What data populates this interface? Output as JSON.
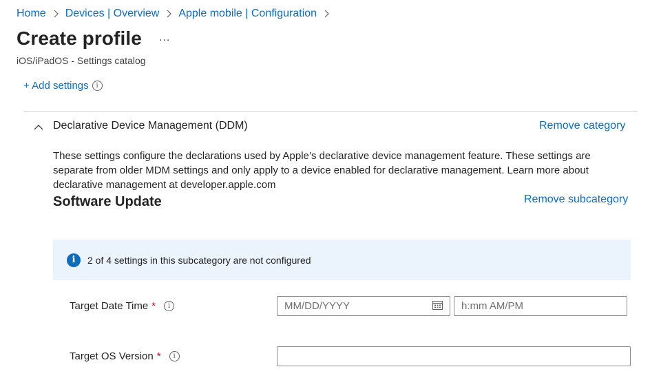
{
  "breadcrumb": [
    "Home",
    "Devices | Overview",
    "Apple mobile | Configuration"
  ],
  "page": {
    "title": "Create profile",
    "more_label": "...",
    "subtitle": "iOS/iPadOS - Settings catalog"
  },
  "add_settings_label": "+ Add settings",
  "category": {
    "title": "Declarative Device Management (DDM)",
    "remove_label": "Remove category",
    "description": "These settings configure the declarations used by Apple’s declarative device management feature. These settings are separate from older MDM settings and only apply to a device enabled for declarative management. Learn more about declarative management at developer.apple.com"
  },
  "subcategory": {
    "title": "Software Update",
    "remove_label": "Remove subcategory",
    "banner_text": "2 of 4 settings in this subcategory are not configured"
  },
  "fields": {
    "target_date_time": {
      "label": "Target Date Time",
      "required_mark": "*",
      "date_placeholder": "MM/DD/YYYY",
      "time_placeholder": "h:mm AM/PM"
    },
    "target_os_version": {
      "label": "Target OS Version",
      "required_mark": "*",
      "value": ""
    }
  },
  "colors": {
    "link": "#0f6cbd",
    "banner_bg": "#ebf3fc",
    "required": "#c50f1f"
  }
}
